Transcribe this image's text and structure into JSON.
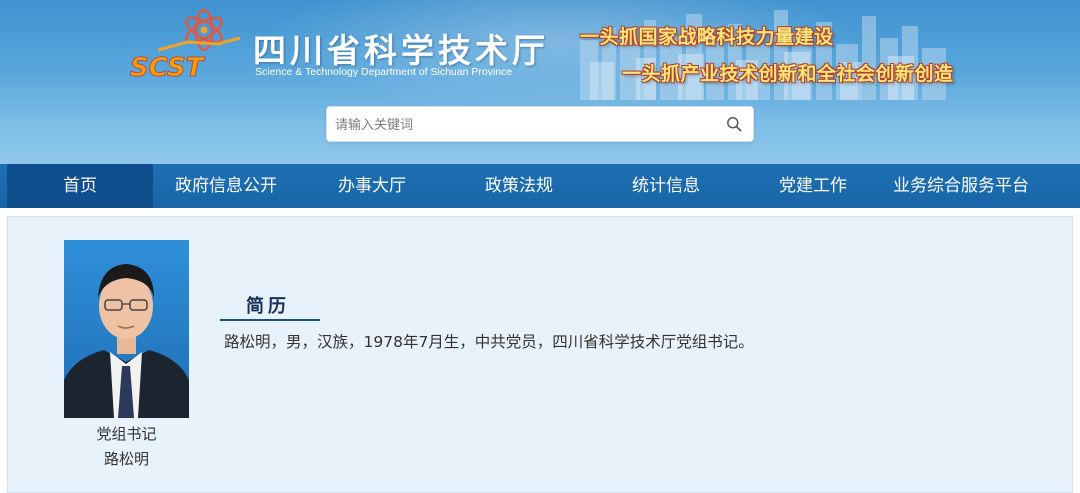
{
  "header": {
    "title_cn": "四川省科学技术厅",
    "title_en": "Science & Technology Department of Sichuan Province",
    "logo_text": "SCST",
    "slogan_1": "一头抓国家战略科技力量建设",
    "slogan_2": "一头抓产业技术创新和全社会创新创造",
    "accent_color": "#1865a8"
  },
  "search": {
    "placeholder": "请输入关键词",
    "value": "",
    "icon": "search-icon"
  },
  "nav": {
    "items": [
      {
        "label": "首页",
        "active": true
      },
      {
        "label": "政府信息公开",
        "active": false
      },
      {
        "label": "办事大厅",
        "active": false
      },
      {
        "label": "政策法规",
        "active": false
      },
      {
        "label": "统计信息",
        "active": false
      },
      {
        "label": "党建工作",
        "active": false
      },
      {
        "label": "业务综合服务平台",
        "active": false
      }
    ]
  },
  "profile": {
    "position": "党组书记",
    "name": "路松明",
    "section_title": "简历",
    "bio": "路松明，男，汉族，1978年7月生，中共党员，四川省科学技术厅党组书记。"
  }
}
